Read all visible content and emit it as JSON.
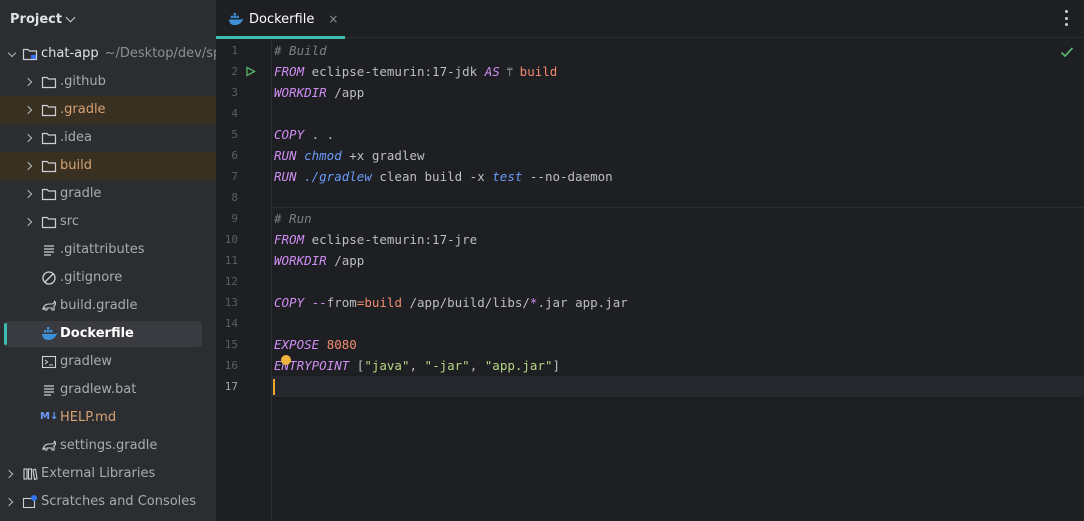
{
  "project_panel": {
    "title": "Project",
    "items": [
      {
        "label": "chat-app",
        "path": "~/Desktop/dev/spi",
        "icon": "module-folder-icon",
        "type": "root"
      },
      {
        "label": ".github",
        "icon": "folder-icon",
        "type": "dir"
      },
      {
        "label": ".gradle",
        "icon": "folder-icon",
        "type": "dir-ignored"
      },
      {
        "label": ".idea",
        "icon": "folder-icon",
        "type": "dir"
      },
      {
        "label": "build",
        "icon": "folder-icon",
        "type": "dir-ignored"
      },
      {
        "label": "gradle",
        "icon": "folder-icon",
        "type": "dir"
      },
      {
        "label": "src",
        "icon": "folder-icon",
        "type": "dir"
      },
      {
        "label": ".gitattributes",
        "icon": "text-file-icon",
        "type": "file"
      },
      {
        "label": ".gitignore",
        "icon": "ignore-file-icon",
        "type": "file"
      },
      {
        "label": "build.gradle",
        "icon": "gradle-elephant-icon",
        "type": "file"
      },
      {
        "label": "Dockerfile",
        "icon": "docker-whale-icon",
        "type": "file-selected"
      },
      {
        "label": "gradlew",
        "icon": "terminal-icon",
        "type": "file"
      },
      {
        "label": "gradlew.bat",
        "icon": "text-file-icon",
        "type": "file"
      },
      {
        "label": "HELP.md",
        "icon": "markdown-icon",
        "icon_text": "M↓",
        "type": "file"
      },
      {
        "label": "settings.gradle",
        "icon": "gradle-elephant-icon",
        "type": "file"
      },
      {
        "label": "External Libraries",
        "icon": "library-icon",
        "type": "top"
      },
      {
        "label": "Scratches and Consoles",
        "icon": "scratches-icon",
        "type": "top"
      }
    ]
  },
  "editor": {
    "tab": {
      "label": "Dockerfile",
      "close": "×"
    },
    "cursor_line": 17,
    "lines": [
      {
        "n": "1",
        "text": "# Build"
      },
      {
        "n": "2",
        "kw": "FROM",
        "rest": " eclipse-temurin:17-jdk ",
        "as": "AS",
        "stage": "build"
      },
      {
        "n": "3",
        "kw": "WORKDIR",
        "rest": " /app"
      },
      {
        "n": "4"
      },
      {
        "n": "5",
        "kw": "COPY",
        "rest": " . ."
      },
      {
        "n": "6",
        "kw": "RUN",
        "cmd": "chmod",
        "rest": " +x gradlew"
      },
      {
        "n": "7",
        "kw": "RUN",
        "cmd": "./gradlew",
        "rest": " clean build -x ",
        "cmd2": "test",
        "rest2": " --no-daemon"
      },
      {
        "n": "8"
      },
      {
        "n": "9",
        "text": "# Run"
      },
      {
        "n": "10",
        "kw": "FROM",
        "rest": " eclipse-temurin:17-jre"
      },
      {
        "n": "11",
        "kw": "WORKDIR",
        "rest": " /app"
      },
      {
        "n": "12"
      },
      {
        "n": "13",
        "kw": "COPY",
        "flag": "--",
        "flagname": "from",
        "eq": "=",
        "stage": "build",
        "rest": " /app/build/libs/",
        "glob": "*",
        "rest2": ".jar app.jar"
      },
      {
        "n": "14"
      },
      {
        "n": "15",
        "kw": "EXPOSE",
        "num": "8080"
      },
      {
        "n": "16",
        "kw": "ENTRYPOINT",
        "open": " [",
        "s1": "\"java\"",
        "s2": "\"-jar\"",
        "s3": "\"app.jar\"",
        "close": "]"
      },
      {
        "n": "17"
      }
    ]
  },
  "colors": {
    "accent": "#3cbcae",
    "keyword": "#cf8ef4",
    "string": "#b6d683",
    "number": "#f28b6e",
    "comment": "#7a7e85",
    "ignored_bg": "#3a3021"
  }
}
